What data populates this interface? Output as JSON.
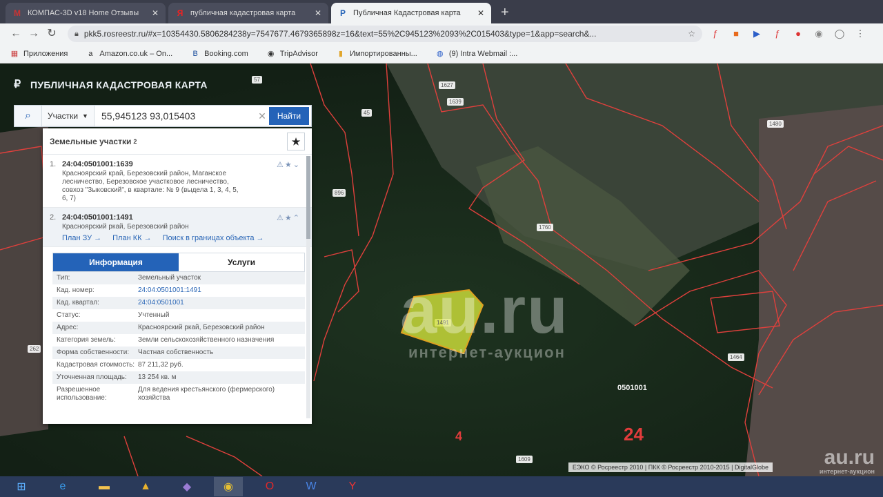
{
  "browser": {
    "tabs": [
      {
        "icon": "М",
        "title": "КОМПАС-3D v18 Home Отзывы",
        "active": false
      },
      {
        "icon": "Я",
        "title": "публичная кадастровая карта",
        "active": false
      },
      {
        "icon": "Р",
        "title": "Публичная Кадастровая карта",
        "active": true
      }
    ],
    "new_tab": "+",
    "url": "pkk5.rosreestr.ru/#x=10354430.5806284238y=7547677.4679365898z=16&text=55%2C945123%2093%2C015403&type=1&app=search&...",
    "bookmarks": [
      {
        "icon": "▦",
        "label": "Приложения"
      },
      {
        "icon": "a",
        "label": "Amazon.co.uk – On..."
      },
      {
        "icon": "B",
        "label": "Booking.com"
      },
      {
        "icon": "◉",
        "label": "TripAdvisor"
      },
      {
        "icon": "▮",
        "label": "Импортированны..."
      },
      {
        "icon": "◍",
        "label": "(9) Intra Webmail :..."
      }
    ]
  },
  "site": {
    "title": "ПУБЛИЧНАЯ КАДАСТРОВАЯ КАРТА",
    "search": {
      "category": "Участки",
      "value": "55,945123 93,015403",
      "button": "Найти"
    }
  },
  "panel": {
    "header": "Земельные участки",
    "count": "2",
    "results": [
      {
        "num": "1.",
        "cad": "24:04:0501001:1639",
        "address": "Красноярский край, Березовский район, Маганское лесничество, Березовское участковое лесничество, совхоз \"Зыковский\", в квартале: № 9 (выдела 1, 3, 4, 5, 6, 7)"
      },
      {
        "num": "2.",
        "cad": "24:04:0501001:1491",
        "address": "Красноярский ркай, Березовский район"
      }
    ],
    "links": [
      "План ЗУ →",
      "План КК →",
      "Поиск в границах объекта →"
    ],
    "info_tabs": {
      "info": "Информация",
      "services": "Услуги"
    },
    "info_rows": [
      {
        "k": "Тип:",
        "v": "Земельный участок",
        "link": false
      },
      {
        "k": "Кад. номер:",
        "v": "24:04:0501001:1491",
        "link": true
      },
      {
        "k": "Кад. квартал:",
        "v": "24:04:0501001",
        "link": true
      },
      {
        "k": "Статус:",
        "v": "Учтенный",
        "link": false
      },
      {
        "k": "Адрес:",
        "v": "Красноярский ркай, Березовский район",
        "link": false
      },
      {
        "k": "Категория земель:",
        "v": "Земли сельскохозяйственного назначения",
        "link": false
      },
      {
        "k": "Форма собственности:",
        "v": "Частная собственность",
        "link": false
      },
      {
        "k": "Кадастровая стоимость:",
        "v": "87 211,32 руб.",
        "link": false
      },
      {
        "k": "Уточненная площадь:",
        "v": "13 254 кв. м",
        "link": false
      },
      {
        "k": "Разрешенное использование:",
        "v": "Для ведения крестьянского (фермерского) хозяйства",
        "link": false
      }
    ]
  },
  "map": {
    "parcel_tags": [
      "57",
      "896",
      "1627",
      "1639",
      "1760",
      "1491",
      "1464",
      "262",
      "1609",
      "45",
      "1480"
    ],
    "quarter_label": "0501001",
    "region_label": "24",
    "sub_label": "4",
    "attribution": "ЕЭКО © Росреестр 2010 | ПКК © Росреестр 2010-2015 | DigitalGlobe",
    "watermark_big": "au.ru",
    "watermark_small": "интернет-аукцион"
  },
  "taskbar": [
    "start",
    "ie",
    "folder",
    "app",
    "vpn",
    "chrome",
    "opera",
    "word",
    "yandex"
  ]
}
